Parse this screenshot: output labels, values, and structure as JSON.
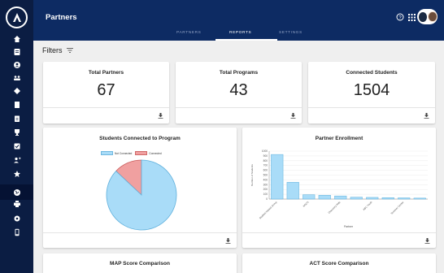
{
  "header": {
    "title": "Partners",
    "tabs": [
      {
        "label": "PARTNERS",
        "active": false
      },
      {
        "label": "REPORTS",
        "active": true
      },
      {
        "label": "SETTINGS",
        "active": false
      }
    ]
  },
  "sidebar": {
    "items": [
      "home-icon",
      "list-icon",
      "account-circle-icon",
      "group-icon",
      "diamond-icon",
      "book-icon",
      "assignment-icon",
      "trophy-icon",
      "checkbox-icon",
      "person-add-icon",
      "star-icon",
      "globe-icon",
      "print-icon",
      "settings-icon",
      "phone-icon"
    ],
    "active_index": 11
  },
  "filters": {
    "label": "Filters"
  },
  "stats": [
    {
      "title": "Total Partners",
      "value": "67"
    },
    {
      "title": "Total Programs",
      "value": "43"
    },
    {
      "title": "Connected Students",
      "value": "1504"
    }
  ],
  "pie_card": {
    "title": "Students Connected to Program"
  },
  "bar_card": {
    "title": "Partner Enrollment"
  },
  "bottom_cards": [
    {
      "title": "MAP Score Comparison"
    },
    {
      "title": "ACT Score Comparison"
    }
  ],
  "colors": {
    "accent": "#0d2b63",
    "sidebar": "#0b1d43",
    "not_connected": "#a9dcf8",
    "connected": "#f0a0a0",
    "bar": "#a9dcf8"
  },
  "chart_data": [
    {
      "type": "pie",
      "title": "Students Connected to Program",
      "series": [
        {
          "name": "Not Connected",
          "value": 87
        },
        {
          "name": "Connected",
          "value": 13
        }
      ],
      "legend": "top"
    },
    {
      "type": "bar",
      "title": "Partner Enrollment",
      "xlabel": "Partner",
      "ylabel": "Number of Students",
      "ylim": [
        0,
        1000
      ],
      "yticks": [
        0,
        100,
        200,
        300,
        400,
        500,
        600,
        700,
        800,
        900,
        1000
      ],
      "categories": [
        "Student Impact Group",
        "",
        "NSCS",
        "",
        "Discovery Kids",
        "",
        "ABC Youth",
        "",
        "Summer Center",
        ""
      ],
      "values": [
        930,
        350,
        90,
        80,
        65,
        40,
        35,
        30,
        25,
        20
      ],
      "grid": true
    }
  ]
}
